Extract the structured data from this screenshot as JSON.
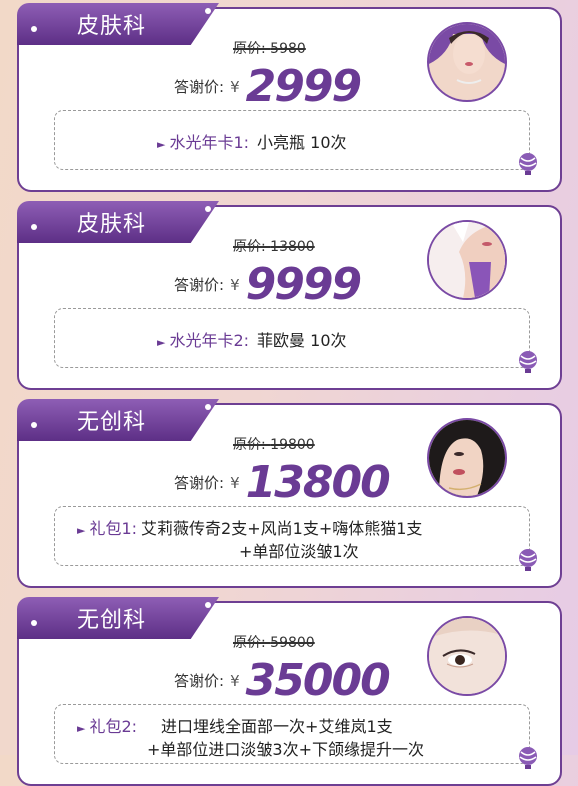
{
  "cards": [
    {
      "category": "皮肤科",
      "original_label": "原价",
      "original_price": "5980",
      "deal_label": "答谢价:",
      "currency": "¥",
      "deal_price": "2999",
      "item_label": "水光年卡1:",
      "item_line1": "小亮瓶  10次",
      "item_line2": ""
    },
    {
      "category": "皮肤科",
      "original_label": "原价",
      "original_price": "13800",
      "deal_label": "答谢价:",
      "currency": "¥",
      "deal_price": "9999",
      "item_label": "水光年卡2:",
      "item_line1": "菲欧曼  10次",
      "item_line2": ""
    },
    {
      "category": "无创科",
      "original_label": "原价",
      "original_price": "19800",
      "deal_label": "答谢价:",
      "currency": "¥",
      "deal_price": "13800",
      "item_label": "礼包1:",
      "item_line1": "艾莉薇传奇2支+风尚1支+嗨体熊猫1支",
      "item_line2": "+单部位淡皱1次"
    },
    {
      "category": "无创科",
      "original_label": "原价",
      "original_price": "59800",
      "deal_label": "答谢价:",
      "currency": "¥",
      "deal_price": "35000",
      "item_label": "礼包2:",
      "item_line1": "进口埋线全面部一次+艾维岚1支",
      "item_line2": "+单部位进口淡皱3次+下颌缘提升一次"
    }
  ],
  "colors": {
    "accent": "#6a3b94",
    "border": "#6e3f93"
  },
  "icons": {
    "photo": "face-photo-icon",
    "balloon": "hot-air-balloon-icon",
    "arrow": "triangle-right-icon"
  }
}
